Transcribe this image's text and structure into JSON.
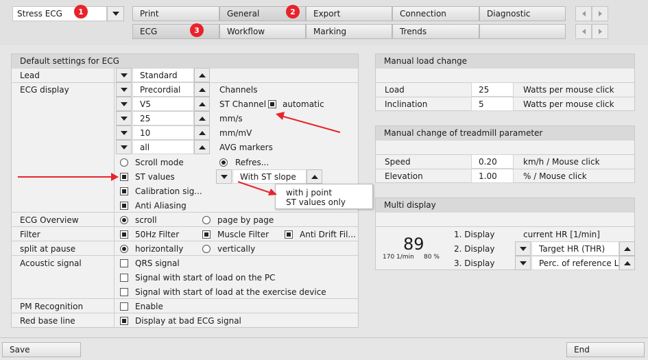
{
  "top": {
    "mode": "Stress ECG",
    "tabs_row1": [
      "Print",
      "General",
      "Export",
      "Connection",
      "Diagnostic"
    ],
    "tabs_row2": [
      "ECG",
      "Workflow",
      "Marking",
      "Trends",
      ""
    ],
    "badges": [
      "1",
      "2",
      "3"
    ]
  },
  "ecg": {
    "header": "Default settings for ECG",
    "lead_label": "Lead",
    "lead_value": "Standard",
    "display_label": "ECG display",
    "display_values": [
      "Precordial",
      "V5",
      "25",
      "10",
      "all"
    ],
    "display_units": [
      "Channels",
      "ST Channel",
      "mm/s",
      "mm/mV",
      "AVG markers"
    ],
    "automatic": "automatic",
    "scroll_mode": "Scroll mode",
    "refresh": "Refres...",
    "st_values": "ST values",
    "st_slope": "With ST slope",
    "calibration": "Calibration sig...",
    "anti_aliasing": "Anti Aliasing",
    "popup_items": [
      "with j point",
      "ST values only"
    ],
    "overview_label": "ECG Overview",
    "overview_scroll": "scroll",
    "overview_page": "page by page",
    "filter_label": "Filter",
    "filter_50hz": "50Hz Filter",
    "filter_muscle": "Muscle Filter",
    "filter_drift": "Anti Drift Fil...",
    "split_label": "split at pause",
    "split_h": "horizontally",
    "split_v": "vertically",
    "acoustic_label": "Acoustic signal",
    "acoustic_qrs": "QRS signal",
    "acoustic_pc": "Signal with start of load on the PC",
    "acoustic_device": "Signal with start of load at the exercise device",
    "pm_label": "PM Recognition",
    "pm_enable": "Enable",
    "red_label": "Red base line",
    "red_display": "Display at bad ECG signal"
  },
  "load": {
    "header": "Manual load change",
    "load_label": "Load",
    "load_value": "25",
    "load_unit": "Watts per mouse click",
    "incl_label": "Inclination",
    "incl_value": "5",
    "incl_unit": "Watts per mouse click"
  },
  "treadmill": {
    "header": "Manual change of treadmill parameter",
    "speed_label": "Speed",
    "speed_value": "0.20",
    "speed_unit": "km/h / Mouse click",
    "elev_label": "Elevation",
    "elev_value": "1.00",
    "elev_unit": "% / Mouse click"
  },
  "multi": {
    "header": "Multi display",
    "big_value": "89",
    "sub_left": "170 1/min",
    "sub_right": "80 %",
    "rows": [
      "1. Display",
      "2. Display",
      "3. Display"
    ],
    "row1_value": "current HR [1/min]",
    "row2_value": "Target HR (THR)",
    "row3_value": "Perc. of reference Lo"
  },
  "bottom": {
    "save": "Save",
    "end": "End"
  },
  "colors": {
    "annotation_red": "#e8232b",
    "background": "#e6e6e6"
  }
}
